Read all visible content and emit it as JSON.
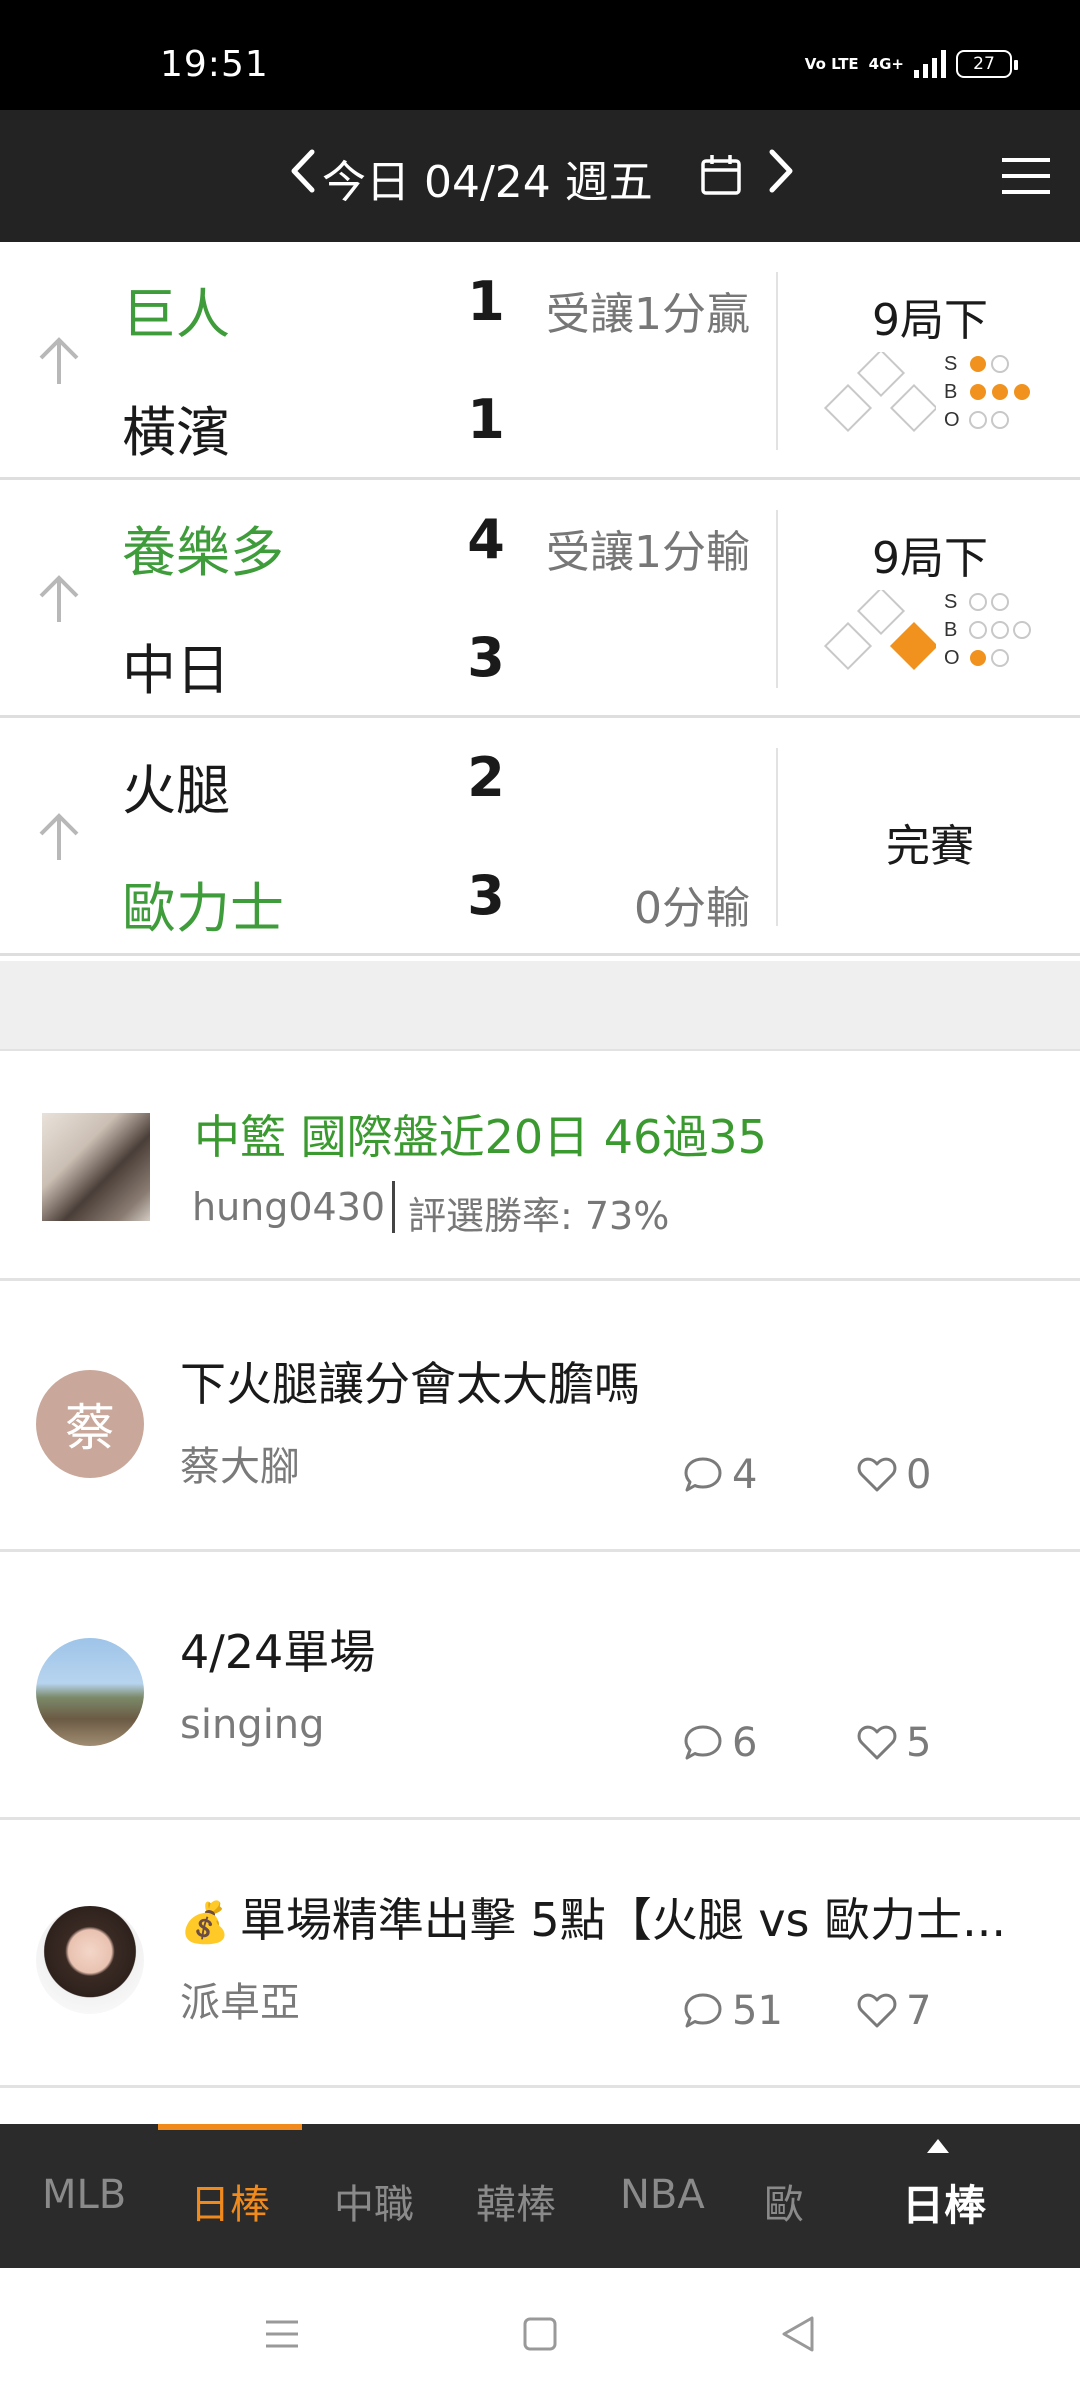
{
  "status_bar": {
    "time": "19:51",
    "volte": "Vo LTE",
    "network": "4G+",
    "battery": "27"
  },
  "header": {
    "date_label": "今日 04/24 週五"
  },
  "games": [
    {
      "team1": "巨人",
      "score1": "1",
      "note1": "受讓1分贏",
      "team1_win": true,
      "team2": "橫濱",
      "score2": "1",
      "note2": "",
      "inning": "9局下",
      "bases": {
        "first": false,
        "second": false,
        "third": false
      },
      "count": {
        "s": 1,
        "b": 3,
        "o": 0
      },
      "sbo_labels": [
        "S",
        "B",
        "O"
      ]
    },
    {
      "team1": "養樂多",
      "score1": "4",
      "note1": "受讓1分輸",
      "team1_win": true,
      "team2": "中日",
      "score2": "3",
      "note2": "",
      "inning": "9局下",
      "bases": {
        "first": true,
        "second": false,
        "third": false
      },
      "count": {
        "s": 0,
        "b": 0,
        "o": 1
      },
      "sbo_labels": [
        "S",
        "B",
        "O"
      ]
    },
    {
      "team1": "火腿",
      "score1": "2",
      "note1": "",
      "team2": "歐力士",
      "score2": "3",
      "note2": "0分輸",
      "team2_win": true,
      "final": "完賽"
    }
  ],
  "featured": {
    "title": "中籃 國際盤近20日 46過35",
    "author": "hung0430",
    "rate": "評選勝率: 73%"
  },
  "posts": [
    {
      "avatar_text": "蔡",
      "title": "下火腿讓分會太大膽嗎",
      "author": "蔡大腳",
      "comments": "4",
      "likes": "0"
    },
    {
      "title": "4/24單場",
      "author": "singing",
      "comments": "6",
      "likes": "5"
    },
    {
      "title": "單場精準出擊 5點【火腿 vs 歐力士...",
      "author": "派卓亞",
      "comments": "51",
      "likes": "7"
    }
  ],
  "tabs": [
    "MLB",
    "日棒",
    "中職",
    "韓棒",
    "NBA",
    "歐"
  ],
  "active_tab": "日棒",
  "current_selection": "日棒",
  "colors": {
    "accent": "#f08a1c",
    "win_green": "#3f9c3b",
    "header_bg": "#232323",
    "tabbar_bg": "#2b2b2b"
  }
}
